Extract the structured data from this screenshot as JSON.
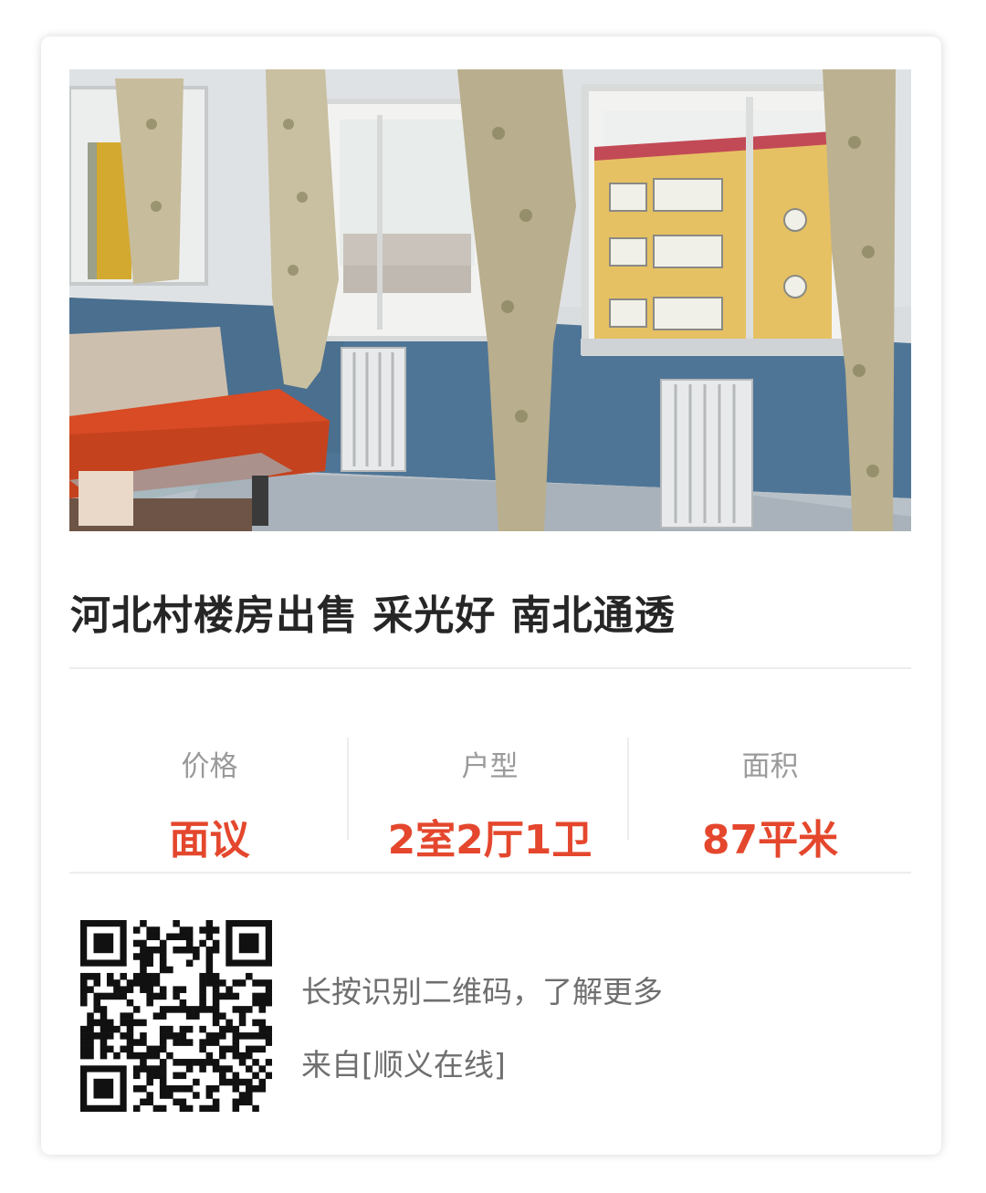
{
  "listing": {
    "title": "河北村楼房出售 采光好 南北通透",
    "photo_icon": "apartment-interior-photo"
  },
  "stats": [
    {
      "label": "价格",
      "value": "面议"
    },
    {
      "label": "户型",
      "value": "2室2厅1卫"
    },
    {
      "label": "面积",
      "value": "87平米"
    }
  ],
  "footer": {
    "qr_icon": "qr-code-icon",
    "hint": "长按识别二维码，了解更多",
    "source": "来自[顺义在线]"
  },
  "colors": {
    "accent": "#e4472d",
    "label": "#9a9a9a",
    "title": "#262626",
    "muted_text": "#6f6f6f"
  }
}
